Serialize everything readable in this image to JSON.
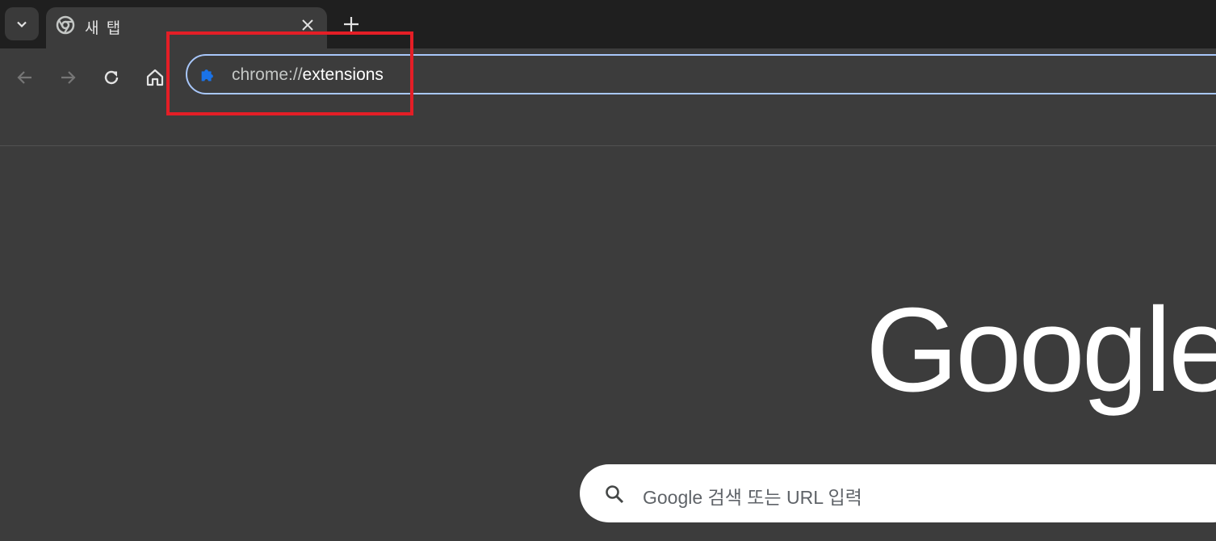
{
  "tabstrip": {
    "tab_search_icon": "chevron-down-icon",
    "tabs": [
      {
        "title": "새 탭",
        "favicon": "chrome-icon",
        "close_icon": "close-icon"
      }
    ],
    "new_tab_icon": "plus-icon"
  },
  "toolbar": {
    "back_icon": "arrow-left-icon",
    "forward_icon": "arrow-right-icon",
    "reload_icon": "reload-icon",
    "home_icon": "home-icon",
    "omnibox": {
      "icon": "puzzle-piece-icon",
      "scheme": "chrome://",
      "path": "extensions"
    }
  },
  "annotation": {
    "highlight_color": "#e41e26"
  },
  "ntp": {
    "logo_text": "Google",
    "search": {
      "placeholder": "Google 검색 또는 URL 입력",
      "icon": "search-icon"
    }
  },
  "colors": {
    "tabstrip_bg": "#1f1f1f",
    "toolbar_bg": "#3c3c3c",
    "omnibox_border": "#a8c7fa",
    "extension_icon": "#1a73e8"
  }
}
